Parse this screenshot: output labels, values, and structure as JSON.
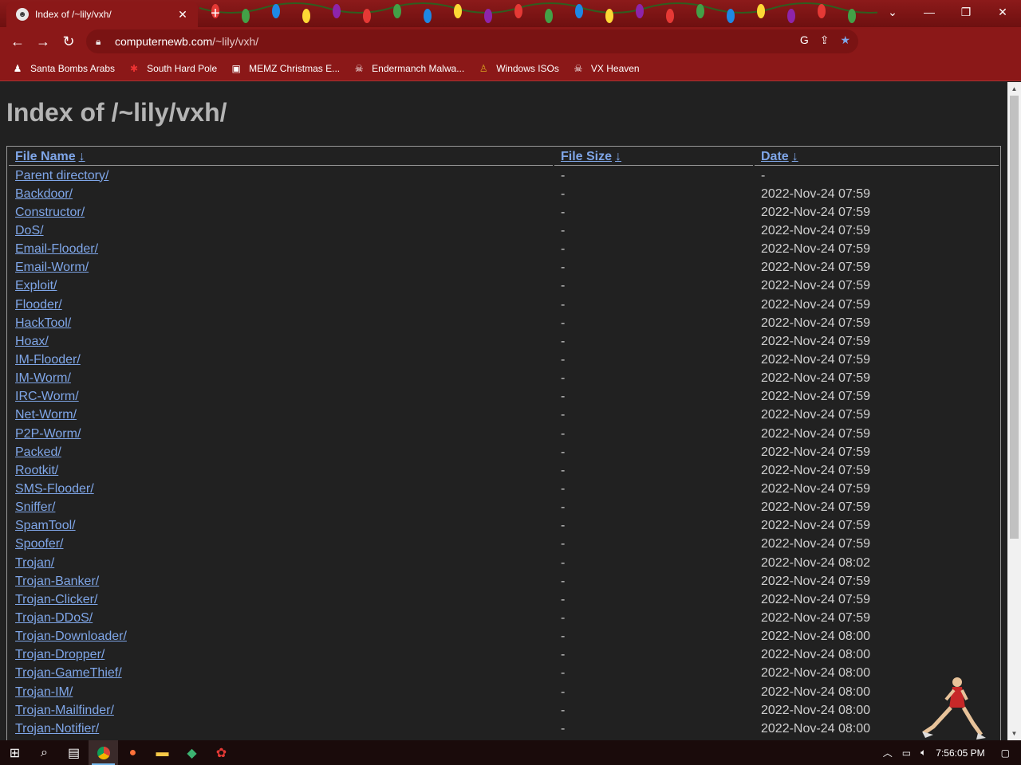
{
  "browser": {
    "tab_title": "Index of /~lily/vxh/",
    "url_host": "computernewb.com",
    "url_path": "/~lily/vxh/"
  },
  "bookmarks": [
    {
      "label": "Santa Bombs Arabs",
      "icon": "santa-icon"
    },
    {
      "label": "South Hard Pole",
      "icon": "snowflake-icon"
    },
    {
      "label": "MEMZ Christmas E...",
      "icon": "memz-icon"
    },
    {
      "label": "Endermanch Malwa...",
      "icon": "skull-icon"
    },
    {
      "label": "Windows ISOs",
      "icon": "figure-icon"
    },
    {
      "label": "VX Heaven",
      "icon": "skull-icon"
    }
  ],
  "page": {
    "heading": "Index of /~lily/vxh/",
    "columns": {
      "name": "File Name",
      "size": "File Size",
      "date": "Date",
      "sort_arrow": "↓"
    },
    "rows": [
      {
        "name": "Parent directory/",
        "size": "-",
        "date": "-"
      },
      {
        "name": "Backdoor/",
        "size": "-",
        "date": "2022-Nov-24 07:59"
      },
      {
        "name": "Constructor/",
        "size": "-",
        "date": "2022-Nov-24 07:59"
      },
      {
        "name": "DoS/",
        "size": "-",
        "date": "2022-Nov-24 07:59"
      },
      {
        "name": "Email-Flooder/",
        "size": "-",
        "date": "2022-Nov-24 07:59"
      },
      {
        "name": "Email-Worm/",
        "size": "-",
        "date": "2022-Nov-24 07:59"
      },
      {
        "name": "Exploit/",
        "size": "-",
        "date": "2022-Nov-24 07:59"
      },
      {
        "name": "Flooder/",
        "size": "-",
        "date": "2022-Nov-24 07:59"
      },
      {
        "name": "HackTool/",
        "size": "-",
        "date": "2022-Nov-24 07:59"
      },
      {
        "name": "Hoax/",
        "size": "-",
        "date": "2022-Nov-24 07:59"
      },
      {
        "name": "IM-Flooder/",
        "size": "-",
        "date": "2022-Nov-24 07:59"
      },
      {
        "name": "IM-Worm/",
        "size": "-",
        "date": "2022-Nov-24 07:59"
      },
      {
        "name": "IRC-Worm/",
        "size": "-",
        "date": "2022-Nov-24 07:59"
      },
      {
        "name": "Net-Worm/",
        "size": "-",
        "date": "2022-Nov-24 07:59"
      },
      {
        "name": "P2P-Worm/",
        "size": "-",
        "date": "2022-Nov-24 07:59"
      },
      {
        "name": "Packed/",
        "size": "-",
        "date": "2022-Nov-24 07:59"
      },
      {
        "name": "Rootkit/",
        "size": "-",
        "date": "2022-Nov-24 07:59"
      },
      {
        "name": "SMS-Flooder/",
        "size": "-",
        "date": "2022-Nov-24 07:59"
      },
      {
        "name": "Sniffer/",
        "size": "-",
        "date": "2022-Nov-24 07:59"
      },
      {
        "name": "SpamTool/",
        "size": "-",
        "date": "2022-Nov-24 07:59"
      },
      {
        "name": "Spoofer/",
        "size": "-",
        "date": "2022-Nov-24 07:59"
      },
      {
        "name": "Trojan/",
        "size": "-",
        "date": "2022-Nov-24 08:02"
      },
      {
        "name": "Trojan-Banker/",
        "size": "-",
        "date": "2022-Nov-24 07:59"
      },
      {
        "name": "Trojan-Clicker/",
        "size": "-",
        "date": "2022-Nov-24 07:59"
      },
      {
        "name": "Trojan-DDoS/",
        "size": "-",
        "date": "2022-Nov-24 07:59"
      },
      {
        "name": "Trojan-Downloader/",
        "size": "-",
        "date": "2022-Nov-24 08:00"
      },
      {
        "name": "Trojan-Dropper/",
        "size": "-",
        "date": "2022-Nov-24 08:00"
      },
      {
        "name": "Trojan-GameThief/",
        "size": "-",
        "date": "2022-Nov-24 08:00"
      },
      {
        "name": "Trojan-IM/",
        "size": "-",
        "date": "2022-Nov-24 08:00"
      },
      {
        "name": "Trojan-Mailfinder/",
        "size": "-",
        "date": "2022-Nov-24 08:00"
      },
      {
        "name": "Trojan-Notifier/",
        "size": "-",
        "date": "2022-Nov-24 08:00"
      }
    ]
  },
  "taskbar": {
    "apps": [
      "windows-start-icon",
      "search-icon",
      "task-view-icon",
      "chrome-icon",
      "firefox-icon",
      "file-explorer-icon",
      "app-icon",
      "app-red-icon"
    ],
    "clock": "7:56:05 PM"
  },
  "colors": {
    "theme_red": "#8b1818",
    "link": "#7fa6e8",
    "page_bg": "#212121"
  }
}
